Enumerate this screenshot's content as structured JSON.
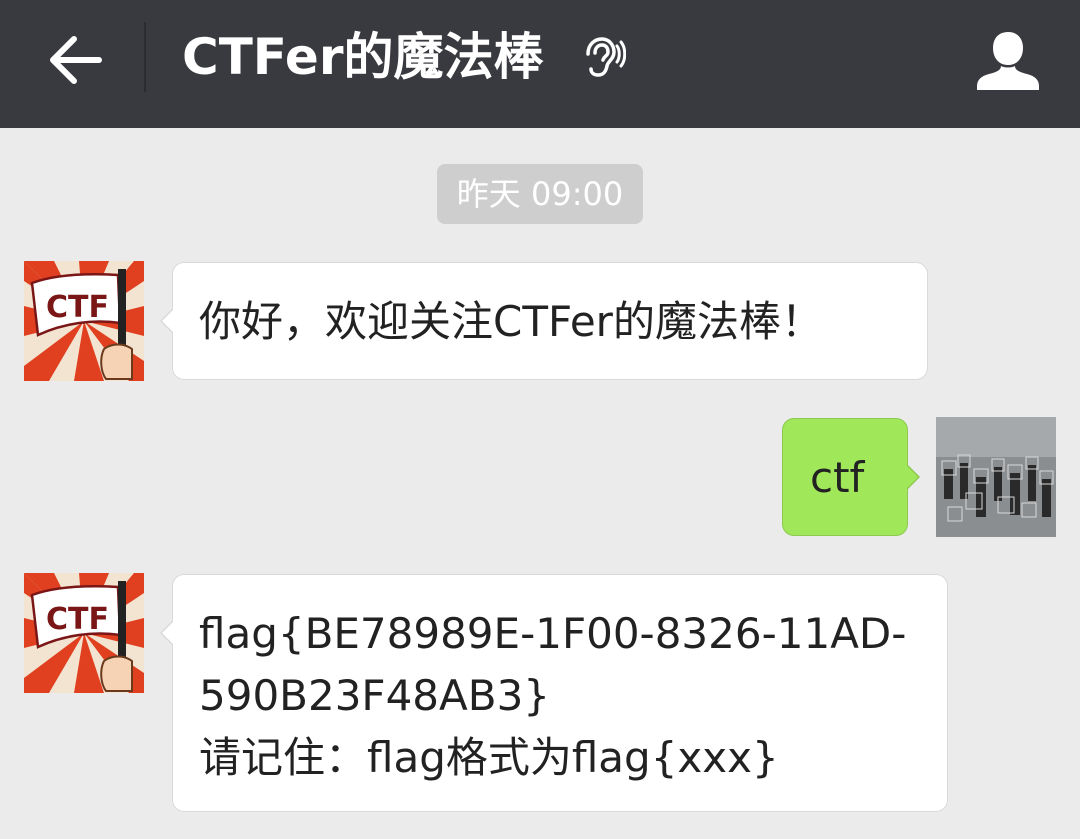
{
  "header": {
    "title": "CTFer的魔法棒",
    "back_icon": "arrow-left-icon",
    "mode_icon": "ear-icon",
    "profile_icon": "person-icon",
    "background": "#393a3f"
  },
  "timestamp": "昨天 09:00",
  "messages": [
    {
      "sender": "CTF",
      "side": "left",
      "avatar_text": "CTF",
      "text": "你好，欢迎关注CTFer的魔法棒！"
    },
    {
      "sender": "user",
      "side": "right",
      "text": "ctf"
    },
    {
      "sender": "CTF",
      "side": "left",
      "avatar_text": "CTF",
      "text": "flag{BE78989E-1F00-8326-11AD-\n590B23F48AB3}\n请记住：flag格式为flag{xxx}"
    }
  ],
  "colors": {
    "chat_background": "#ebebeb",
    "incoming_bubble": "#ffffff",
    "outgoing_bubble": "#a0e75a"
  }
}
